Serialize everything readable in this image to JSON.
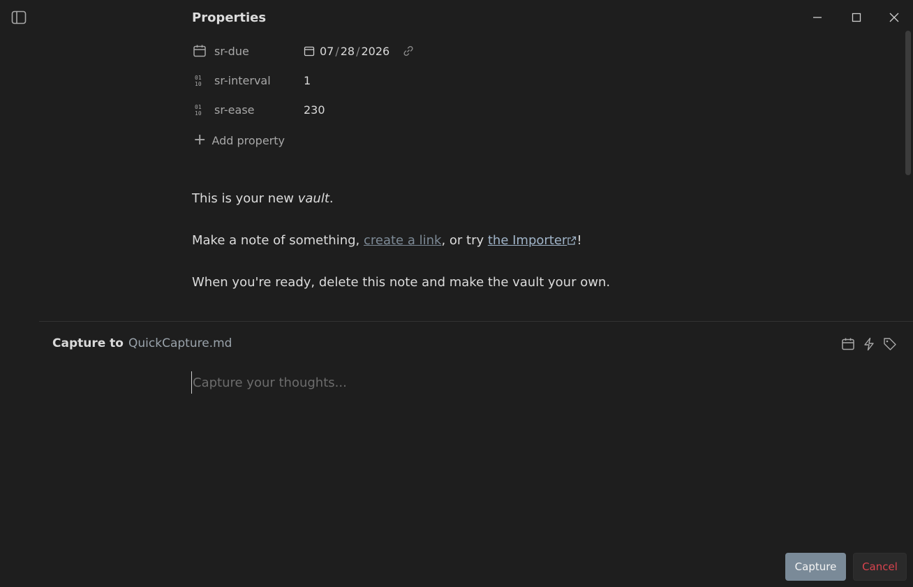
{
  "properties": {
    "title": "Properties",
    "items": [
      {
        "key": "sr-due",
        "icon": "calendar-icon",
        "value_date": {
          "month": "07",
          "day": "28",
          "year": "2026",
          "sep": "/"
        }
      },
      {
        "key": "sr-interval",
        "icon": "number-icon",
        "value": "1"
      },
      {
        "key": "sr-ease",
        "icon": "number-icon",
        "value": "230"
      }
    ],
    "add_label": "Add property"
  },
  "note": {
    "line1_prefix": "This is your new ",
    "line1_em": "vault",
    "line1_suffix": ".",
    "line2_prefix": "Make a note of something, ",
    "line2_link1": "create a link",
    "line2_middle": ", or try ",
    "line2_link2": "the Importer",
    "line2_suffix": "!",
    "line3": "When you're ready, delete this note and make the vault your own."
  },
  "capture": {
    "label": "Capture to",
    "target": "QuickCapture.md",
    "placeholder": "Capture your thoughts...",
    "value": "",
    "toolbar_icons": [
      "calendar-icon",
      "lightning-icon",
      "tag-icon"
    ]
  },
  "buttons": {
    "capture": "Capture",
    "cancel": "Cancel"
  },
  "colors": {
    "background": "#1e1e1e",
    "accent_button": "#7a8a98",
    "cancel_text": "#d9434e",
    "link": "#a0b4c8"
  }
}
